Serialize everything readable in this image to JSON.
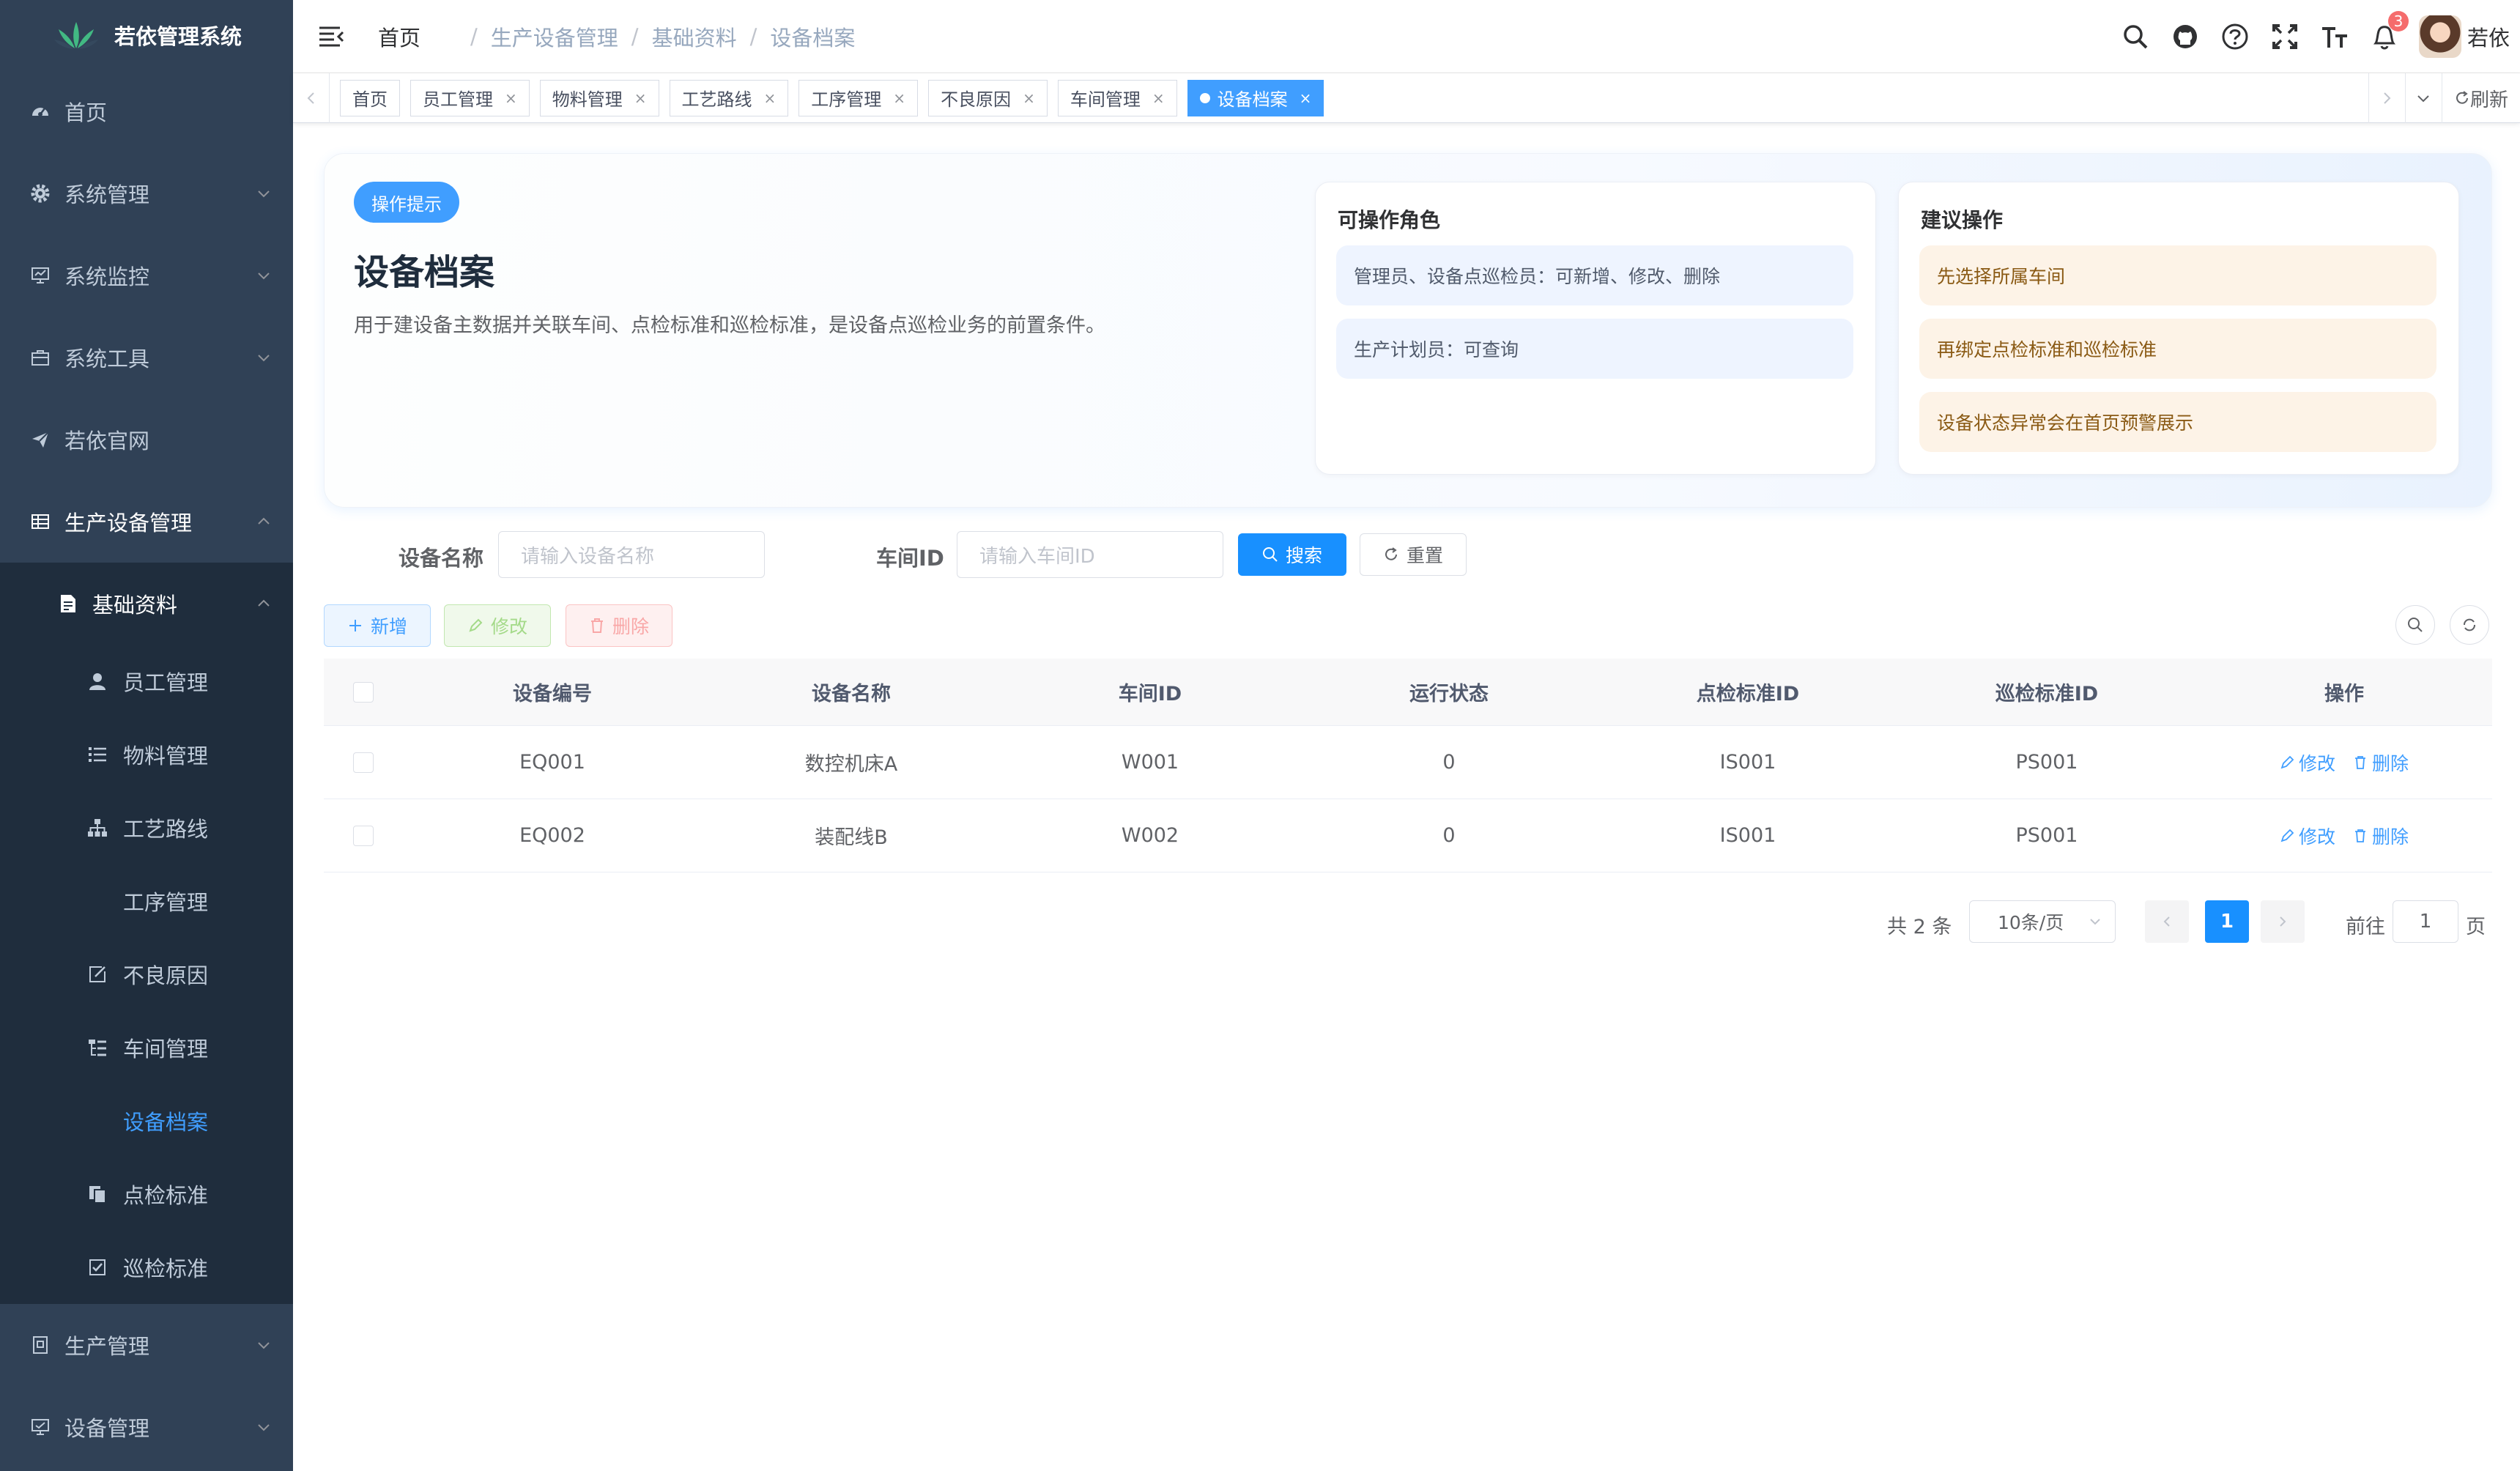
{
  "sidebar": {
    "title": "若依管理系统",
    "items": [
      {
        "label": "首页"
      },
      {
        "label": "系统管理"
      },
      {
        "label": "系统监控"
      },
      {
        "label": "系统工具"
      },
      {
        "label": "若依官网"
      },
      {
        "label": "生产设备管理"
      }
    ],
    "sub_group": "基础资料",
    "leaves": [
      {
        "label": "员工管理"
      },
      {
        "label": "物料管理"
      },
      {
        "label": "工艺路线"
      },
      {
        "label": "工序管理"
      },
      {
        "label": "不良原因"
      },
      {
        "label": "车间管理"
      },
      {
        "label": "设备档案"
      },
      {
        "label": "点检标准"
      },
      {
        "label": "巡检标准"
      }
    ],
    "bottom_items": [
      {
        "label": "生产管理"
      },
      {
        "label": "设备管理"
      }
    ]
  },
  "navbar": {
    "breadcrumb": [
      "首页",
      "生产设备管理",
      "基础资料",
      "设备档案"
    ],
    "notification_count": "3",
    "user_name": "若依"
  },
  "tags": {
    "items": [
      "首页",
      "员工管理",
      "物料管理",
      "工艺路线",
      "工序管理",
      "不良原因",
      "车间管理",
      "设备档案"
    ],
    "close_mark": "×",
    "refresh_label": "刷新"
  },
  "hero": {
    "pill": "操作提示",
    "title": "设备档案",
    "desc": "用于建设备主数据并关联车间、点检标准和巡检标准，是设备点巡检业务的前置条件。",
    "roles_title": "可操作角色",
    "roles": [
      "管理员、设备点巡检员：可新增、修改、删除",
      "生产计划员：可查询"
    ],
    "suggest_title": "建议操作",
    "suggestions": [
      "先选择所属车间",
      "再绑定点检标准和巡检标准",
      "设备状态异常会在首页预警展示"
    ]
  },
  "search": {
    "name_label": "设备名称",
    "name_placeholder": "请输入设备名称",
    "workshop_label": "车间ID",
    "workshop_placeholder": "请输入车间ID",
    "search_btn": "搜索",
    "reset_btn": "重置"
  },
  "toolbar": {
    "add": "新增",
    "edit": "修改",
    "delete": "删除"
  },
  "table": {
    "headers": [
      "设备编号",
      "设备名称",
      "车间ID",
      "运行状态",
      "点检标准ID",
      "巡检标准ID",
      "操作"
    ],
    "rows": [
      [
        "EQ001",
        "数控机床A",
        "W001",
        "0",
        "IS001",
        "PS001"
      ],
      [
        "EQ002",
        "装配线B",
        "W002",
        "0",
        "IS001",
        "PS001"
      ]
    ],
    "op_edit": "修改",
    "op_delete": "删除"
  },
  "pagination": {
    "total": "共 2 条",
    "page_size": "10条/页",
    "current": "1",
    "goto_prefix": "前往",
    "goto_value": "1",
    "goto_suffix": "页"
  }
}
